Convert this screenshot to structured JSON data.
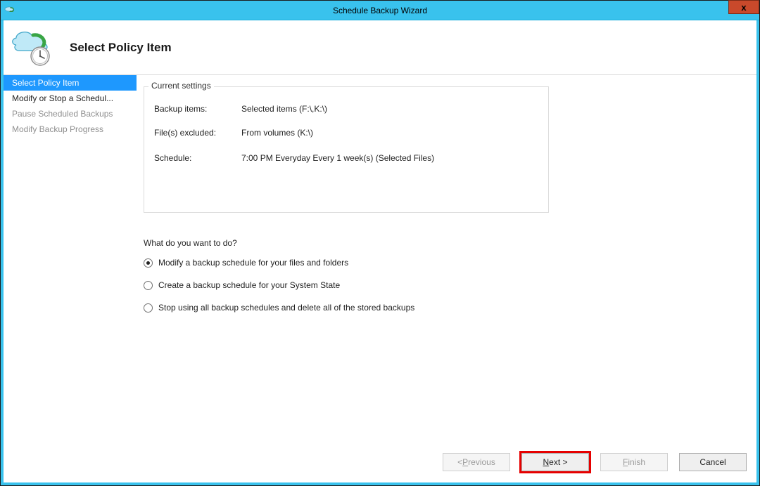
{
  "window": {
    "title": "Schedule Backup Wizard",
    "close_glyph": "x"
  },
  "header": {
    "title": "Select Policy Item"
  },
  "sidebar": {
    "items": [
      {
        "label": "Select Policy Item",
        "state": "selected"
      },
      {
        "label": "Modify or Stop a Schedul...",
        "state": "enabled"
      },
      {
        "label": "Pause Scheduled Backups",
        "state": "disabled"
      },
      {
        "label": "Modify Backup Progress",
        "state": "disabled"
      }
    ]
  },
  "settings": {
    "group_label": "Current settings",
    "rows": {
      "backup_items_k": "Backup items:",
      "backup_items_v": "Selected items (F:\\,K:\\)",
      "files_excluded_k": "File(s) excluded:",
      "files_excluded_v": "From volumes (K:\\)",
      "schedule_k": "Schedule:",
      "schedule_v": "7:00 PM Everyday Every 1 week(s) (Selected Files)"
    }
  },
  "prompt": "What do you want to do?",
  "options": [
    {
      "label": "Modify a backup schedule for your files and folders",
      "checked": true
    },
    {
      "label": "Create a backup schedule for your System State",
      "checked": false
    },
    {
      "label": "Stop using all backup schedules and delete all of the stored backups",
      "checked": false
    }
  ],
  "buttons": {
    "previous": {
      "prefix": "< ",
      "mnemonic": "P",
      "rest": "revious",
      "enabled": false
    },
    "next": {
      "mnemonic": "N",
      "rest": "ext >",
      "enabled": true,
      "highlight": true
    },
    "finish": {
      "mnemonic": "F",
      "rest": "inish",
      "enabled": false
    },
    "cancel": {
      "label": "Cancel",
      "enabled": true
    }
  }
}
